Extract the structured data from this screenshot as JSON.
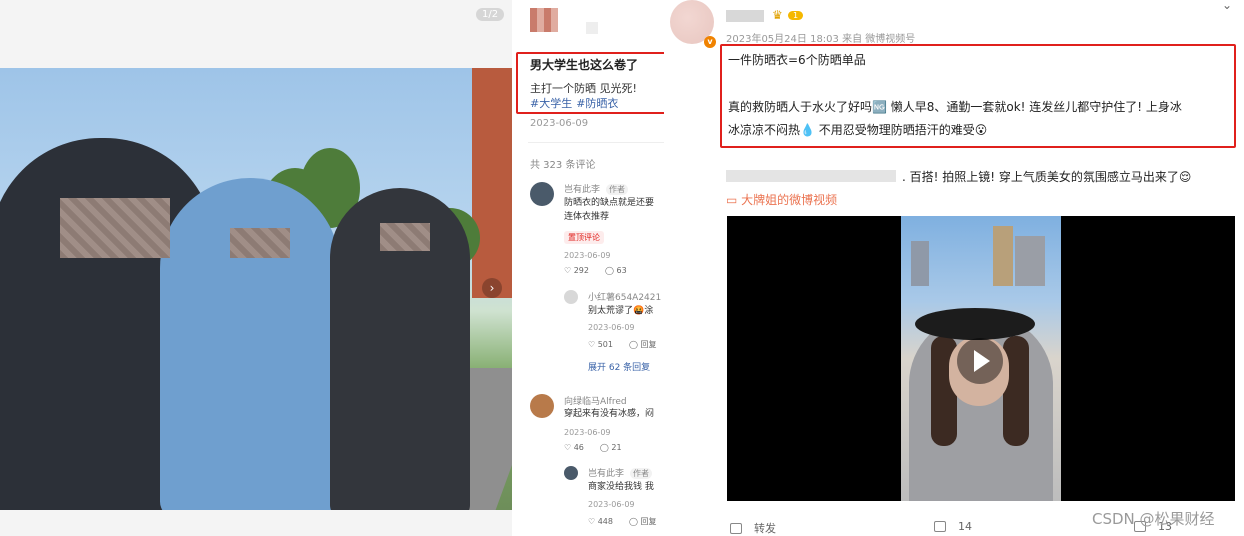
{
  "left_post": {
    "page_counter": "1/2",
    "title": "男大学生也这么卷了",
    "body": "主打一个防晒 见光死!",
    "tags": [
      "#大学生",
      "#防晒衣"
    ],
    "date": "2023-06-09",
    "comment_count": "共 323 条评论",
    "comments": [
      {
        "name": "岂有此李",
        "author_tag": "作者",
        "text_lines": [
          "防晒衣的缺点就是还要",
          "连体衣推荐"
        ],
        "pin": "置顶评论",
        "date": "2023-06-09",
        "likes": "292",
        "replies": "63"
      },
      {
        "name": "小红薯654A2421",
        "text": "别太荒谬了🤬涂",
        "date": "2023-06-09",
        "likes": "501",
        "reply_label": "回复",
        "expand": "展开 62 条回复"
      },
      {
        "name": "向绿临马Alfred",
        "text": "穿起来有没有冰感，闷",
        "date": "2023-06-09",
        "likes": "46",
        "replies": "21"
      },
      {
        "name": "岂有此李",
        "author_tag": "作者",
        "text": "商家没给我钱 我",
        "date": "2023-06-09",
        "likes": "448",
        "reply_label": "回复"
      }
    ]
  },
  "weibo": {
    "level": "1",
    "meta": "2023年05月24日 18:03  来自 微博视频号",
    "verified_badge": "v",
    "text_lines": [
      "一件防晒衣=6个防晒单品",
      "真的救防晒人于水火了好吗🆖 懒人早8、通勤一套就ok! 连发丝儿都守护住了! 上身冰",
      "冰凉凉不闷热💧 不用忍受物理防晒捂汗的难受😮"
    ],
    "repost_text": ". 百搭! 拍照上镜! 穿上气质美女的氛围感立马出来了😌",
    "video_link": "大牌姐的微博视频",
    "actions": {
      "repost": "转发",
      "comments": "14",
      "likes": "13"
    }
  },
  "watermark": "CSDN @松果财经",
  "colors": {
    "highlight": "#e0201c",
    "link_blue": "#3a63a8",
    "weibo_orange": "#eb7350"
  }
}
